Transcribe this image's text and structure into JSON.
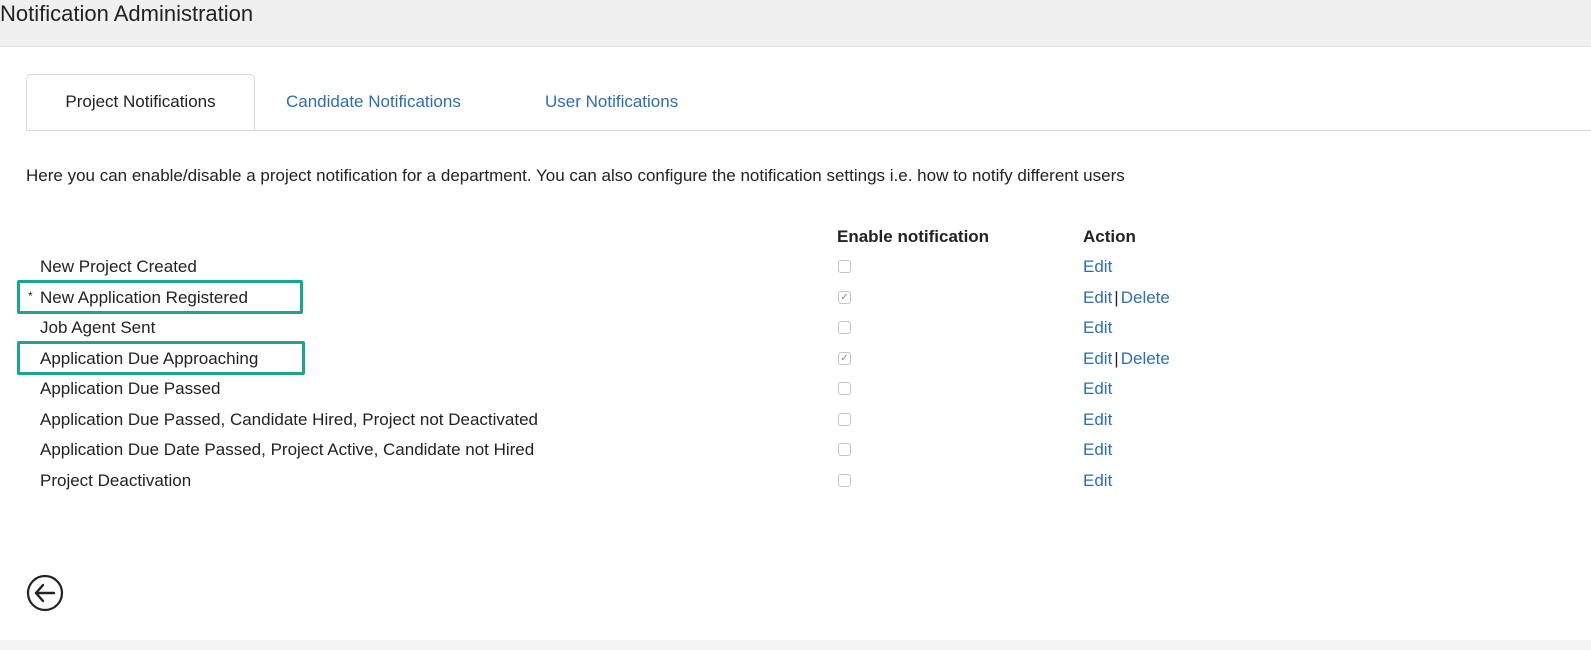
{
  "header": {
    "title": "Notification Administration"
  },
  "tabs": [
    {
      "label": "Project Notifications",
      "active": true
    },
    {
      "label": "Candidate Notifications",
      "active": false
    },
    {
      "label": "User Notifications",
      "active": false
    }
  ],
  "description": "Here you can enable/disable a project notification for a department. You can also configure the notification settings i.e. how to notify different users",
  "table": {
    "headers": {
      "enable": "Enable notification",
      "action": "Action"
    },
    "action_labels": {
      "edit": "Edit",
      "delete": "Delete",
      "separator": "|"
    },
    "rows": [
      {
        "name": "New Project Created",
        "enabled": false,
        "marker": "",
        "deletable": false,
        "highlighted": false
      },
      {
        "name": "New Application Registered",
        "enabled": true,
        "marker": "*",
        "deletable": true,
        "highlighted": true
      },
      {
        "name": "Job Agent Sent",
        "enabled": false,
        "marker": "",
        "deletable": false,
        "highlighted": false
      },
      {
        "name": "Application Due Approaching",
        "enabled": true,
        "marker": "",
        "deletable": true,
        "highlighted": true
      },
      {
        "name": "Application Due Passed",
        "enabled": false,
        "marker": "",
        "deletable": false,
        "highlighted": false
      },
      {
        "name": "Application Due Passed, Candidate Hired, Project not Deactivated",
        "enabled": false,
        "marker": "",
        "deletable": false,
        "highlighted": false
      },
      {
        "name": "Application Due Date Passed, Project Active, Candidate not Hired",
        "enabled": false,
        "marker": "",
        "deletable": false,
        "highlighted": false
      },
      {
        "name": "Project Deactivation",
        "enabled": false,
        "marker": "",
        "deletable": false,
        "highlighted": false
      }
    ]
  },
  "icons": {
    "back": "back-arrow-circle-icon",
    "check": "checkmark-icon"
  },
  "colors": {
    "link": "#2e6eb0",
    "highlight_border": "#1aa58c"
  }
}
